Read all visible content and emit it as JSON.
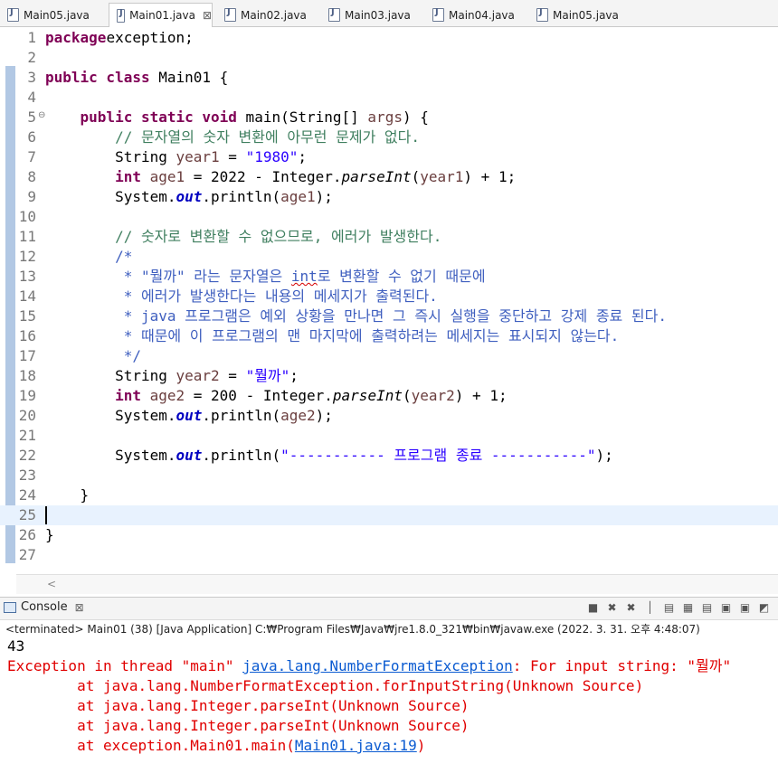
{
  "tabs": [
    {
      "label": "Main05.java",
      "active": false
    },
    {
      "label": "Main01.java",
      "active": true
    },
    {
      "label": "Main02.java",
      "active": false
    },
    {
      "label": "Main03.java",
      "active": false
    },
    {
      "label": "Main04.java",
      "active": false
    },
    {
      "label": "Main05.java",
      "active": false
    }
  ],
  "tab_close": "⊠",
  "editor": {
    "line_numbers": [
      "1",
      "2",
      "3",
      "4",
      "5",
      "6",
      "7",
      "8",
      "9",
      "10",
      "11",
      "12",
      "13",
      "14",
      "15",
      "16",
      "17",
      "18",
      "19",
      "20",
      "21",
      "22",
      "23",
      "24",
      "25",
      "26",
      "27"
    ],
    "current_line": "25",
    "fold_marker": "⊖",
    "scroll_left_arrow": "<",
    "lines": [
      [
        [
          "kw",
          "package"
        ],
        [
          "",
          "exception;"
        ]
      ],
      [],
      [
        [
          "kw",
          "public class"
        ],
        [
          "",
          " Main01 {"
        ]
      ],
      [],
      [
        [
          "",
          "    "
        ],
        [
          "kw",
          "public static void"
        ],
        [
          "",
          " main(String[] "
        ],
        [
          "var",
          "args"
        ],
        [
          "",
          ") {"
        ]
      ],
      [
        [
          "",
          "        "
        ],
        [
          "cmt",
          "// 문자열의 숫자 변환에 아무런 문제가 없다."
        ]
      ],
      [
        [
          "",
          "        String "
        ],
        [
          "var",
          "year1"
        ],
        [
          "",
          " = "
        ],
        [
          "str",
          "\"1980\""
        ],
        [
          "",
          ";"
        ]
      ],
      [
        [
          "",
          "        "
        ],
        [
          "kw",
          "int"
        ],
        [
          "",
          " "
        ],
        [
          "var",
          "age1"
        ],
        [
          "",
          " = 2022 - Integer."
        ],
        [
          "it",
          "parseInt"
        ],
        [
          "",
          "("
        ],
        [
          "var",
          "year1"
        ],
        [
          "",
          ") + 1;"
        ]
      ],
      [
        [
          "",
          "        System."
        ],
        [
          "fld",
          "out"
        ],
        [
          "",
          ".println("
        ],
        [
          "var",
          "age1"
        ],
        [
          "",
          ");"
        ]
      ],
      [],
      [
        [
          "",
          "        "
        ],
        [
          "cmt",
          "// 숫자로 변환할 수 없으므로, 에러가 발생한다."
        ]
      ],
      [
        [
          "",
          "        "
        ],
        [
          "bcmt",
          "/*"
        ]
      ],
      [
        [
          "",
          "         "
        ],
        [
          "bcmt",
          "* \"뭘까\" 라는 문자열은 "
        ],
        [
          "bcmt squig",
          "int"
        ],
        [
          "bcmt",
          "로 변환할 수 없기 때문에"
        ]
      ],
      [
        [
          "",
          "         "
        ],
        [
          "bcmt",
          "* 에러가 발생한다는 내용의 메세지가 출력된다."
        ]
      ],
      [
        [
          "",
          "         "
        ],
        [
          "bcmt",
          "* java 프로그램은 예외 상황을 만나면 그 즉시 실행을 중단하고 강제 종료 된다."
        ]
      ],
      [
        [
          "",
          "         "
        ],
        [
          "bcmt",
          "* 때문에 이 프로그램의 맨 마지막에 출력하려는 메세지는 표시되지 않는다."
        ]
      ],
      [
        [
          "",
          "         "
        ],
        [
          "bcmt",
          "*/"
        ]
      ],
      [
        [
          "",
          "        String "
        ],
        [
          "var",
          "year2"
        ],
        [
          "",
          " = "
        ],
        [
          "str",
          "\"뭘까\""
        ],
        [
          "",
          ";"
        ]
      ],
      [
        [
          "",
          "        "
        ],
        [
          "kw",
          "int"
        ],
        [
          "",
          " "
        ],
        [
          "var",
          "age2"
        ],
        [
          "",
          " = 200 - Integer."
        ],
        [
          "it",
          "parseInt"
        ],
        [
          "",
          "("
        ],
        [
          "var",
          "year2"
        ],
        [
          "",
          ") + 1;"
        ]
      ],
      [
        [
          "",
          "        System."
        ],
        [
          "fld",
          "out"
        ],
        [
          "",
          ".println("
        ],
        [
          "var",
          "age2"
        ],
        [
          "",
          ");"
        ]
      ],
      [],
      [
        [
          "",
          "        System."
        ],
        [
          "fld",
          "out"
        ],
        [
          "",
          ".println("
        ],
        [
          "str",
          "\"----------- 프로그램 종료 -----------\""
        ],
        [
          "",
          ");"
        ]
      ],
      [],
      [
        [
          "",
          "    }"
        ]
      ],
      [],
      [
        [
          "",
          "}"
        ]
      ],
      []
    ]
  },
  "console": {
    "tab_label": "Console",
    "tab_close": "⊠",
    "terminated": "<terminated> Main01 (38) [Java Application] C:₩Program Files₩Java₩jre1.8.0_321₩bin₩javaw.exe (2022. 3. 31. 오후 4:48:07)",
    "tool_icons": [
      "terminate-icon",
      "remove-launch-icon",
      "remove-all-icon",
      "scroll-lock-icon",
      "word-wrap-icon",
      "show-stdout-icon",
      "show-stderr-icon",
      "pin-icon",
      "display-console-icon",
      "open-console-icon"
    ],
    "tool_glyphs": [
      "■",
      "✖",
      "✖",
      "│",
      "▤",
      "▦",
      "▤",
      "▣",
      "▣",
      "◩"
    ],
    "output": {
      "line1": "43",
      "line2_prefix": "Exception in thread \"main\" ",
      "line2_link": "java.lang.NumberFormatException",
      "line2_suffix": ": For input string: \"뭘까\"",
      "line3": "        at java.lang.NumberFormatException.forInputString(Unknown Source)",
      "line4": "        at java.lang.Integer.parseInt(Unknown Source)",
      "line5": "        at java.lang.Integer.parseInt(Unknown Source)",
      "line6_prefix": "        at exception.Main01.main(",
      "line6_link": "Main01.java:19",
      "line6_suffix": ")"
    }
  }
}
